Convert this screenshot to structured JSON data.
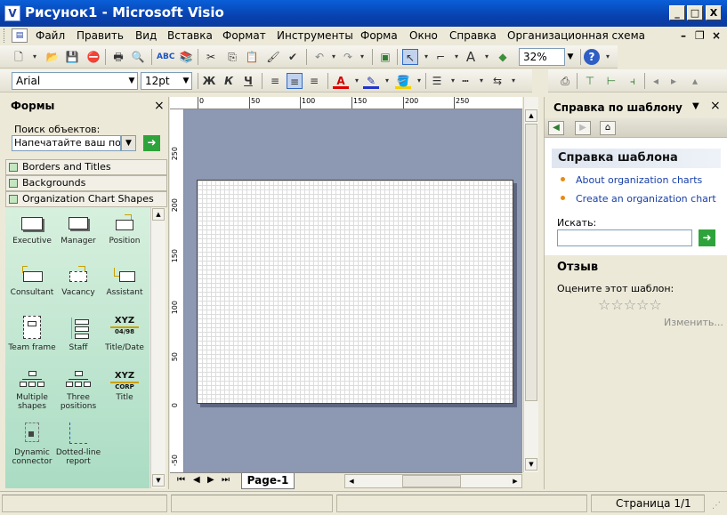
{
  "window": {
    "title": "Рисунок1 - Microsoft Visio",
    "app_icon": "visio-icon"
  },
  "window_controls": {
    "minimize": "_",
    "maximize": "□",
    "close": "X"
  },
  "menu": {
    "items": [
      "Файл",
      "Править",
      "Вид",
      "Вставка",
      "Формат",
      "Инструменты",
      "Форма",
      "Окно",
      "Справка",
      "Организационная схема"
    ],
    "doc_controls": {
      "minimize": "–",
      "restore": "❐",
      "close": "×"
    }
  },
  "toolbar": {
    "zoom": "32%",
    "font": "Arial",
    "font_size": "12pt",
    "bold": "Ж",
    "italic": "К",
    "underline": "Ч"
  },
  "shapes_pane": {
    "title": "Формы",
    "close": "×",
    "search_label": "Поиск объектов:",
    "search_placeholder": "Напечатайте ваш поиск",
    "stencils": [
      "Borders and Titles",
      "Backgrounds",
      "Organization Chart Shapes"
    ],
    "shapes": [
      {
        "label": "Executive"
      },
      {
        "label": "Manager"
      },
      {
        "label": "Position"
      },
      {
        "label": "Consultant"
      },
      {
        "label": "Vacancy"
      },
      {
        "label": "Assistant"
      },
      {
        "label": "Team frame"
      },
      {
        "label": "Staff"
      },
      {
        "label": "Title/Date",
        "icon_text": "XYZ",
        "icon_sub": "04/98"
      },
      {
        "label": "Multiple shapes"
      },
      {
        "label": "Three positions"
      },
      {
        "label": "Title",
        "icon_text": "XYZ",
        "icon_sub": "CORP"
      },
      {
        "label": "Dynamic connector"
      },
      {
        "label": "Dotted-line report"
      }
    ]
  },
  "rulers": {
    "top": [
      "0",
      "50",
      "100",
      "150",
      "200",
      "250"
    ],
    "left": [
      "250",
      "200",
      "150",
      "100",
      "50",
      "0",
      "-50"
    ]
  },
  "page_tabs": {
    "active": "Page-1"
  },
  "task_pane": {
    "title": "Справка по шаблону",
    "help_section": "Справка шаблона",
    "links": [
      "About organization charts",
      "Create an organization chart"
    ],
    "search_label": "Искать:",
    "feedback_section": "Отзыв",
    "rate_label": "Оцените этот шаблон:",
    "rating": 0,
    "change_link": "Изменить..."
  },
  "status": {
    "page": "Страница 1/1"
  }
}
